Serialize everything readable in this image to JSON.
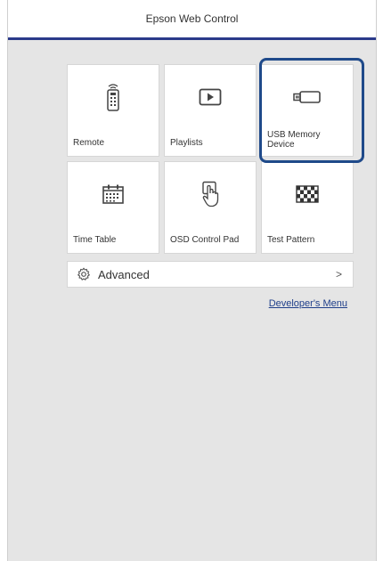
{
  "header": {
    "title": "Epson Web Control"
  },
  "tiles": [
    {
      "label": "Remote",
      "icon": "remote-icon"
    },
    {
      "label": "Playlists",
      "icon": "play-icon"
    },
    {
      "label": "USB Memory\nDevice",
      "icon": "usb-icon",
      "selected": true
    },
    {
      "label": "Time Table",
      "icon": "calendar-icon"
    },
    {
      "label": "OSD Control Pad",
      "icon": "touch-hand-icon"
    },
    {
      "label": "Test Pattern",
      "icon": "checker-icon"
    }
  ],
  "advanced": {
    "label": "Advanced",
    "chevron": ">"
  },
  "developer_link": "Developer's Menu",
  "colors": {
    "accent": "#2b3a8a",
    "highlight": "#1f4a8a",
    "link": "#1f3f8a",
    "background": "#e5e5e5"
  }
}
